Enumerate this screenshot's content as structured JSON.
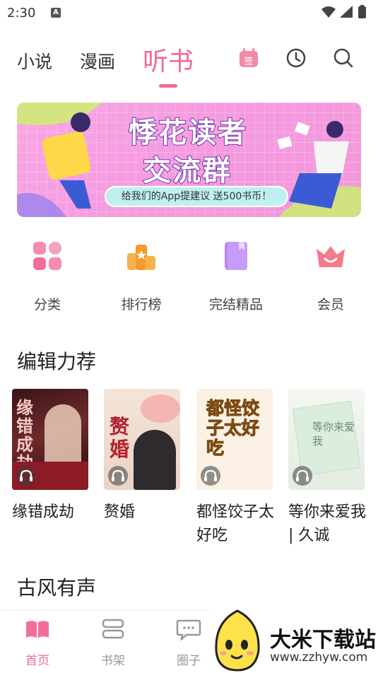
{
  "status_bar": {
    "time": "2:30",
    "notification_glyph": "A",
    "icons": [
      "wifi-icon",
      "signal-icon",
      "battery-icon"
    ]
  },
  "top_nav": {
    "tabs": [
      {
        "label": "小说",
        "active": false
      },
      {
        "label": "漫画",
        "active": false
      },
      {
        "label": "听书",
        "active": true
      }
    ],
    "checkin_label": "签",
    "icons": [
      "checkin-icon",
      "history-icon",
      "search-icon"
    ],
    "accent_color": "#f06b95"
  },
  "banner": {
    "title_line1": "悸花读者",
    "title_line2": "交流群",
    "subtitle": "给我们的App提建议 送500书币！"
  },
  "quick_menu": [
    {
      "label": "分类",
      "icon": "category-grid-icon"
    },
    {
      "label": "排行榜",
      "icon": "ranking-podium-icon"
    },
    {
      "label": "完结精品",
      "icon": "book-icon"
    },
    {
      "label": "会员",
      "icon": "crown-icon"
    }
  ],
  "sections": {
    "editor_picks": {
      "title": "编辑力荐",
      "books": [
        {
          "title": "缘错成劫",
          "cover_text": "缘错成劫"
        },
        {
          "title": "赘婚",
          "cover_text": "赘婚"
        },
        {
          "title": "都怪饺子太好吃",
          "cover_text": "都怪饺子太好吃"
        },
        {
          "title": "等你来爱我 | 久诚",
          "cover_text": "等你来爱我"
        }
      ]
    },
    "ancient": {
      "title": "古风有声"
    }
  },
  "bottom_bar": {
    "items": [
      {
        "label": "首页",
        "icon": "home-book-icon",
        "active": true
      },
      {
        "label": "书架",
        "icon": "bookshelf-icon",
        "active": false
      },
      {
        "label": "圈子",
        "icon": "chat-bubble-icon",
        "active": false
      }
    ]
  },
  "watermark": {
    "name": "大米下载站",
    "url": "www.zzhyw.com"
  }
}
